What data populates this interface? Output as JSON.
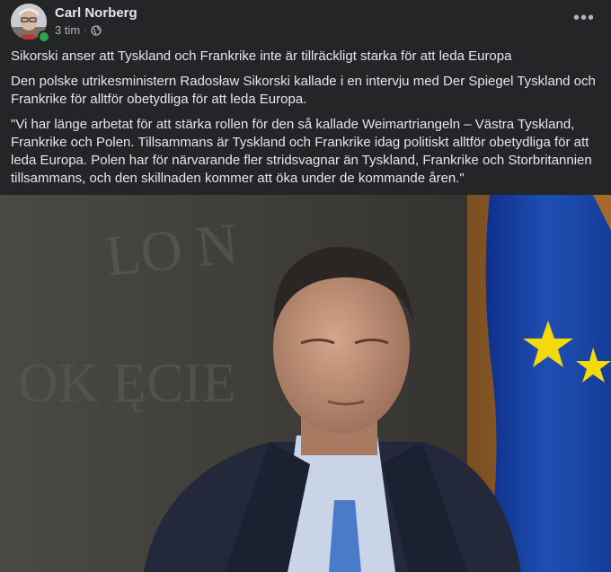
{
  "post": {
    "author": "Carl Norberg",
    "time": "3 tim",
    "separator": "·",
    "more_label": "•••",
    "paragraphs": [
      "Sikorski anser att Tyskland och Frankrike inte är tillräckligt starka för att leda Europa",
      "Den polske utrikesministern Radosław Sikorski kallade i en intervju med Der Spiegel Tyskland och Frankrike för alltför obetydliga för att leda Europa.",
      "\"Vi har länge arbetat för att stärka rollen för den så kallade Weimartriangeln – Västra Tyskland, Frankrike och Polen. Tillsammans är Tyskland och Frankrike idag politiskt alltför obetydliga för att leda Europa. Polen har för närvarande fler stridsvagnar än Tyskland, Frankrike och Storbritannien tillsammans, och den skillnaden kommer att öka under de kommande åren.\""
    ],
    "photo_wall_text": [
      "LO N",
      "OK ĘCIE"
    ],
    "visibility_icon": "globe-icon",
    "colors": {
      "background": "#242526",
      "text": "#e4e6eb",
      "secondary_text": "#b0b3b8",
      "online": "#31a24c",
      "eu_flag": "#1f4fb3",
      "eu_star": "#f5d90a"
    }
  }
}
